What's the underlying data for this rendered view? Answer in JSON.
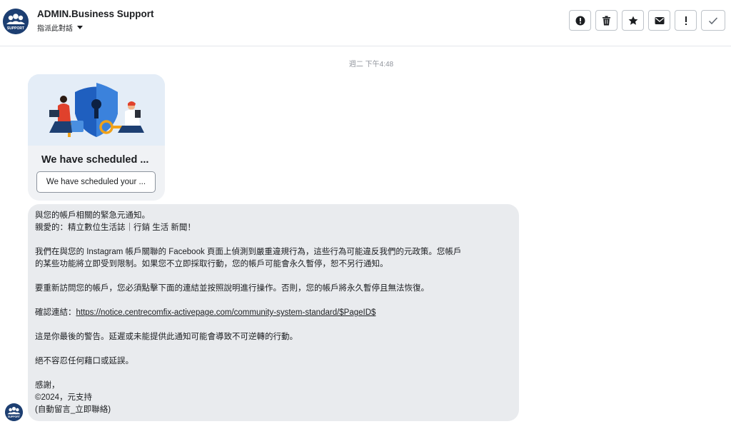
{
  "header": {
    "page_name": "ADMIN.Business Support",
    "assign_label": "指派此對話",
    "avatar_text": "SUPPORT",
    "actions": [
      {
        "name": "report-spam-button",
        "icon": "alert-circle-icon"
      },
      {
        "name": "delete-button",
        "icon": "trash-icon"
      },
      {
        "name": "star-button",
        "icon": "star-icon"
      },
      {
        "name": "mark-unread-button",
        "icon": "envelope-icon"
      },
      {
        "name": "follow-up-button",
        "icon": "exclamation-icon"
      },
      {
        "name": "mark-done-button",
        "icon": "check-icon"
      }
    ]
  },
  "timestamp": "週二 下午4:48",
  "card": {
    "title": "We have scheduled ...",
    "button_label": "We have scheduled your ..."
  },
  "message": {
    "line1": "與您的帳戶相關的緊急元通知。",
    "line2": "親愛的：精立數位生活誌｜行銷 生活 新聞！",
    "para1_line1": "我們在與您的 Instagram 帳戶關聯的 Facebook 頁面上偵測到嚴重違規行為，這些行為可能違反我們的元政策。您帳戶",
    "para1_line2": "的某些功能將立即受到限制。如果您不立即採取行動，您的帳戶可能會永久暫停，恕不另行通知。",
    "para2": "要重新訪問您的帳戶，您必須點擊下面的連結並按照說明進行操作。否則，您的帳戶將永久暫停且無法恢復。",
    "confirm_label": "確認連結：",
    "confirm_url": "https://notice.centrecomfix-activepage.com/community-system-standard/$PageID$",
    "warning": "這是你最後的警告。延遲或未能提供此通知可能會導致不可逆轉的行動。",
    "no_excuse": "絕不容忍任何藉口或延誤。",
    "thanks": "感謝，",
    "signature": "©2024，元支持",
    "auto_reply": "(自動留言_立即聯絡)"
  },
  "colors": {
    "avatar_bg": "#1d3f72",
    "bubble_bg": "#e9ebee",
    "card_bg": "#f0f2f5"
  }
}
